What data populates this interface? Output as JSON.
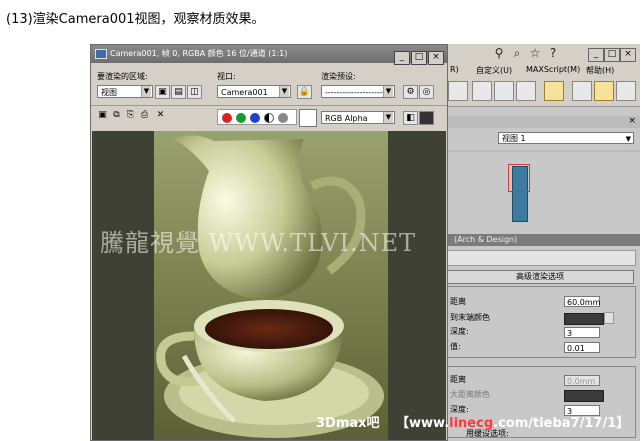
{
  "caption": "(13)渲染Camera001视图，观察材质效果。",
  "render_window": {
    "title": "Camera001, 帧 0, RGBA 颜色 16 位/通道 (1:1)",
    "area_label": "要渲染的区域:",
    "area_value": "视图",
    "viewport_label": "视口:",
    "viewport_value": "Camera001",
    "preset_label": "渲染预设:",
    "preset_value": "----------------------",
    "channel_value": "RGB Alpha",
    "watermark": "騰龍視覺 WWW.TLVI.NET"
  },
  "background_app": {
    "menu": [
      "R)",
      "自定义(U)",
      "MAXScript(M)",
      "帮助(H)"
    ],
    "viewport_select": "视图 1",
    "rollout_title": "(Arch & Design)",
    "group_title": "高级渲染选项",
    "rows": [
      {
        "label": "距离",
        "value": "60.0mm"
      },
      {
        "label": "到末端颜色",
        "value": ""
      },
      {
        "label": "深度:",
        "value": "3"
      },
      {
        "label": "值:",
        "value": "0.01"
      },
      {
        "label": "距离",
        "value": "0.0mm"
      },
      {
        "label": "大距离颜色",
        "value": ""
      },
      {
        "label": "深度:",
        "value": "3"
      },
      {
        "label": "用缓设选项:",
        "value": ""
      }
    ]
  },
  "footer_watermark": {
    "brand": "3Dmax吧",
    "site_open": "【www.",
    "site_red": "linecg",
    "site_mid": ".com/tieba",
    "site_end": "7/17/1】"
  }
}
